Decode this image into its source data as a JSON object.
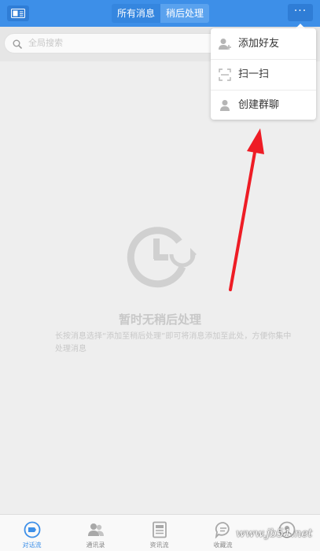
{
  "header": {
    "tabs": [
      {
        "label": "所有消息"
      },
      {
        "label": "稍后处理"
      }
    ],
    "more_label": "···"
  },
  "search": {
    "placeholder": "全局搜索"
  },
  "empty_state": {
    "title": "暂时无稍后处理",
    "description": "长按消息选择“添加至稍后处理”即可将消息添加至此处，方便你集中处理消息"
  },
  "menu": {
    "items": [
      {
        "label": "添加好友",
        "icon": "add-friend-icon"
      },
      {
        "label": "扫一扫",
        "icon": "scan-icon"
      },
      {
        "label": "创建群聊",
        "icon": "create-group-icon"
      }
    ]
  },
  "bottom_nav": {
    "tabs": [
      {
        "label": "对话流",
        "icon": "chat-icon",
        "active": true
      },
      {
        "label": "通讯录",
        "icon": "contacts-icon"
      },
      {
        "label": "资讯流",
        "icon": "news-icon"
      },
      {
        "label": "收藏流",
        "icon": "favorites-icon"
      },
      {
        "label": "",
        "icon": "profile-icon"
      }
    ]
  },
  "watermark": "www.jb51.net",
  "colors": {
    "header_bg": "#3d8fe8",
    "accent": "#3d8fe8",
    "annotation_arrow": "#ee1c25",
    "empty_text": "#c8c8c8"
  }
}
